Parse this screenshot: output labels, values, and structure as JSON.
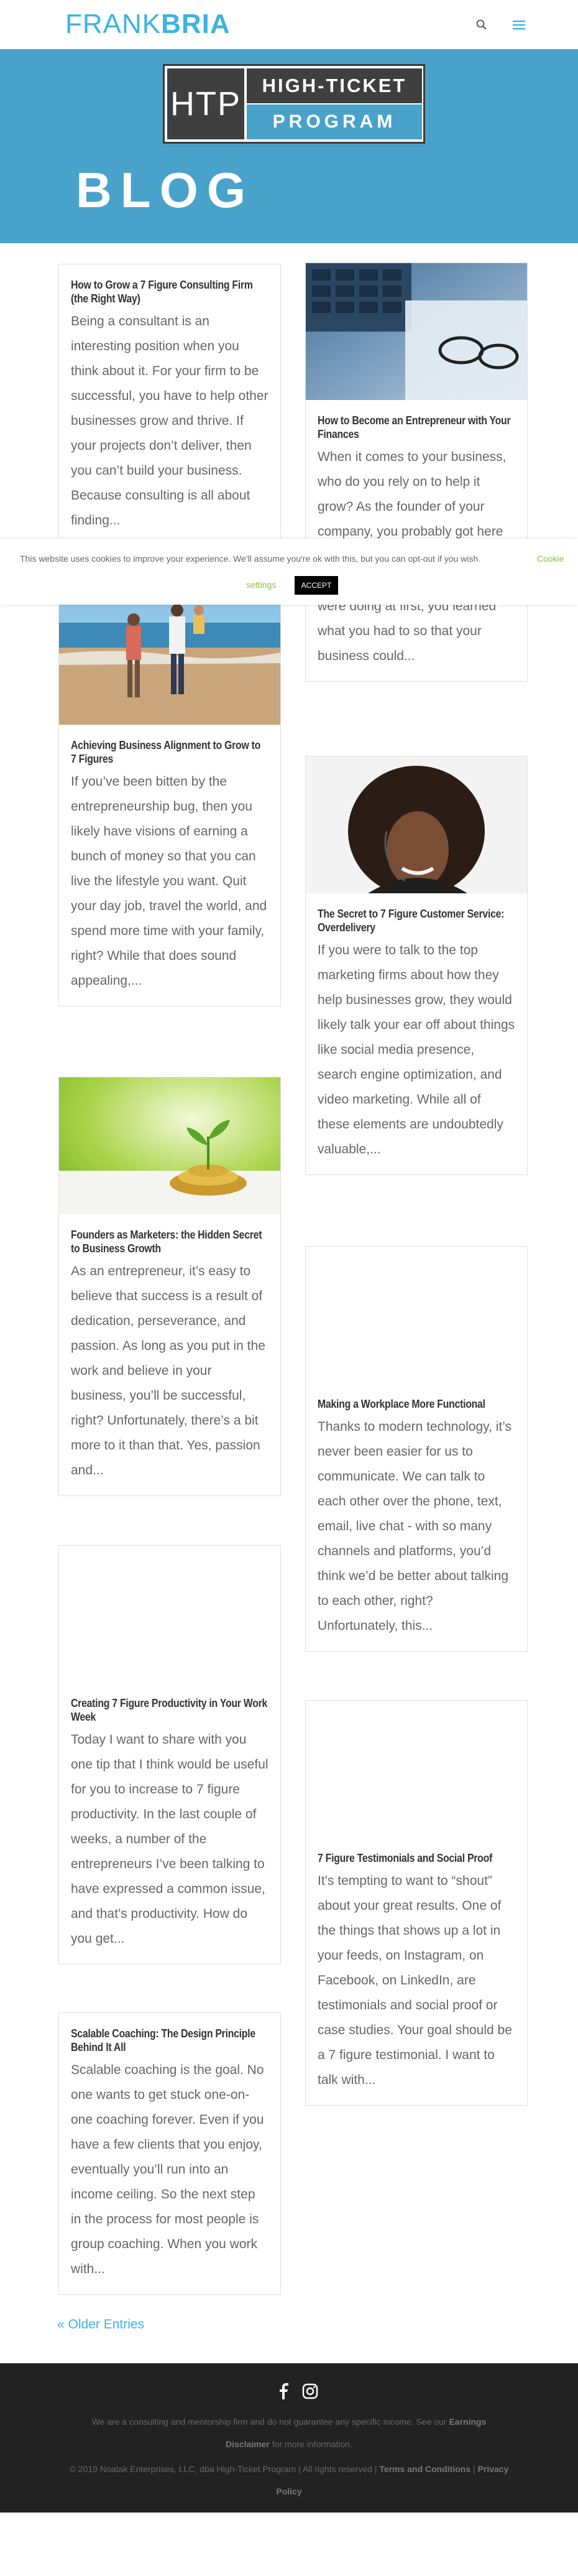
{
  "header": {
    "logo_thin": "FRANK",
    "logo_bold": "BRIA"
  },
  "hero": {
    "badge_left": "HTP",
    "badge_top": "HIGH-TICKET",
    "badge_bottom": "PROGRAM",
    "title": "BLOG"
  },
  "cookie": {
    "text": "This website uses cookies to improve your experience. We'll assume you're ok with this, but you can opt-out if you wish.",
    "settings_part1": "Cookie",
    "settings_part2": "settings",
    "accept": "ACCEPT"
  },
  "posts": [
    {
      "title": "How to Grow a 7 Figure Consulting Firm (the Right Way)",
      "excerpt": "Being a consultant is an interesting position when you think about it. For your firm to be successful, you have to help other businesses grow and thrive. If your projects don’t deliver, then you can’t build your business. Because consulting is all about finding..."
    },
    {
      "title": "How to Become an Entrepreneur with Your Finances",
      "excerpt": "When it comes to your business, who do you rely on to help it grow? As the founder of your company, you probably got here by relying on yourself. And while you may have known what you were doing at first, you learned what you had to so that your business could..."
    },
    {
      "title": "Achieving Business Alignment to Grow to 7 Figures",
      "excerpt": "If you’ve been bitten by the entrepreneurship bug, then you likely have visions of earning a bunch of money so that you can live the lifestyle you want. Quit your day job, travel the world, and spend more time with your family, right? While that does sound appealing,..."
    },
    {
      "title": "The Secret to 7 Figure Customer Service: Overdelivery",
      "excerpt": "If you were to talk to the top marketing firms about how they help businesses grow, they would likely talk your ear off about things like social media presence, search engine optimization, and video marketing. While all of these elements are undoubtedly valuable,..."
    },
    {
      "title": "Founders as Marketers: the Hidden Secret to Business Growth",
      "excerpt": "As an entrepreneur, it’s easy to believe that success is a result of dedication, perseverance, and passion. As long as you put in the work and believe in your business, you’ll be successful, right? Unfortunately, there’s a bit more to it than that. Yes, passion and..."
    },
    {
      "title": "Making a Workplace More Functional",
      "excerpt": "Thanks to modern technology, it’s never been easier for us to communicate. We can talk to each other over the phone, text, email, live chat - with so many channels and platforms, you’d think we’d be better about talking to each other, right? Unfortunately, this..."
    },
    {
      "title": "Creating 7 Figure Productivity in Your Work Week",
      "excerpt": "Today I want to share with you one tip that I think would be useful for you to increase to 7 figure productivity. In the last couple of weeks, a number of the entrepreneurs I’ve been talking to have expressed a common issue, and that’s productivity. How do you get..."
    },
    {
      "title": "7 Figure Testimonials and Social Proof",
      "excerpt": "It’s tempting to want to “shout” about your great results. One of the things that shows up a lot in your feeds, on Instagram, on Facebook, on LinkedIn, are testimonials and social proof or case studies. Your goal should be a 7 figure testimonial. I want to talk with..."
    },
    {
      "title": "Scalable Coaching: The Design Principle Behind It All",
      "excerpt": "Scalable coaching is the goal. No one wants to get stuck one-on-one coaching forever. Even if you have a few clients that you enjoy, eventually you’ll run into an income ceiling. So the next step in the process for most people is group coaching. When you work with..."
    }
  ],
  "pagination": {
    "older": "« Older Entries"
  },
  "footer": {
    "disclaimer_text": "We are a consulting and mentorship firm and do not guarantee any specific income. See our",
    "earnings_link": "Earnings",
    "disclaimer_link": "Disclaimer",
    "disclaimer_tail": "for more information.",
    "copyright": "© 2019 Noatak Enterprises, LLC, dba High-Ticket Program | All rights reserved |",
    "terms": "Terms and Conditions",
    "sep": "|",
    "privacy": "Privacy",
    "policy": "Policy"
  },
  "colors": {
    "accent": "#3db3e0",
    "hero": "#48a2ca",
    "footer": "#222222",
    "cookie_link": "#87c040"
  }
}
